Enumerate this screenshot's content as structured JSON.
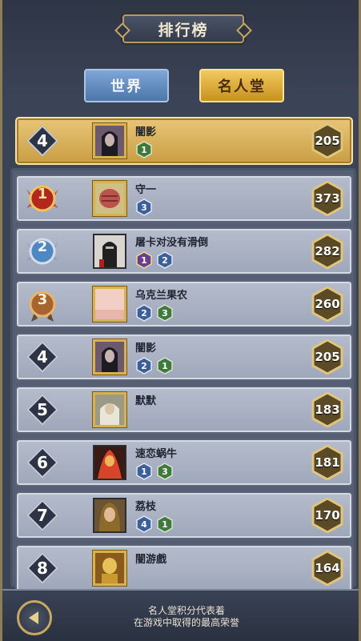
{
  "header": {
    "title": "排行榜"
  },
  "tabs": [
    {
      "label": "世界",
      "active": false,
      "color": "#5b84b8"
    },
    {
      "label": "名人堂",
      "active": true,
      "color": "#d9a531"
    }
  ],
  "my_rank": {
    "rank": "4",
    "name": "闇影",
    "badges": [
      "1"
    ],
    "score": "205"
  },
  "rows": [
    {
      "rank": "1",
      "medal": "gold",
      "name": "守一",
      "badges": [
        "3"
      ],
      "score": "373",
      "avatar_icon": "fist-icon"
    },
    {
      "rank": "2",
      "medal": "silver",
      "name": "屠卡对没有滑倒",
      "badges": [
        "1",
        "2"
      ],
      "score": "282",
      "avatar_icon": "knight-icon"
    },
    {
      "rank": "3",
      "medal": "bronze",
      "name": "乌克兰果农",
      "badges": [
        "2",
        "3"
      ],
      "score": "260",
      "avatar_icon": "landscape-icon"
    },
    {
      "rank": "4",
      "medal": "",
      "name": "闇影",
      "badges": [
        "2",
        "1"
      ],
      "score": "205",
      "avatar_icon": "dark-hero-icon"
    },
    {
      "rank": "5",
      "medal": "",
      "name": "默默",
      "badges": [],
      "score": "183",
      "avatar_icon": "sage-icon"
    },
    {
      "rank": "6",
      "medal": "",
      "name": "速恋蜗牛",
      "badges": [
        "1",
        "3"
      ],
      "score": "181",
      "avatar_icon": "flame-warrior-icon"
    },
    {
      "rank": "7",
      "medal": "",
      "name": "荔枝",
      "badges": [
        "4",
        "1"
      ],
      "score": "170",
      "avatar_icon": "lady-icon"
    },
    {
      "rank": "8",
      "medal": "",
      "name": "闇游戲",
      "badges": [],
      "score": "164",
      "avatar_icon": "golden-idol-icon"
    }
  ],
  "footer": {
    "line1": "名人堂积分代表着",
    "line2": "在游戏中取得的最高荣誉"
  },
  "colors": {
    "score_hex": "#5b4a26",
    "badge_blue": "#3b5f9a",
    "badge_green": "#3f7a3c",
    "badge_purple": "#6b3f8f"
  }
}
